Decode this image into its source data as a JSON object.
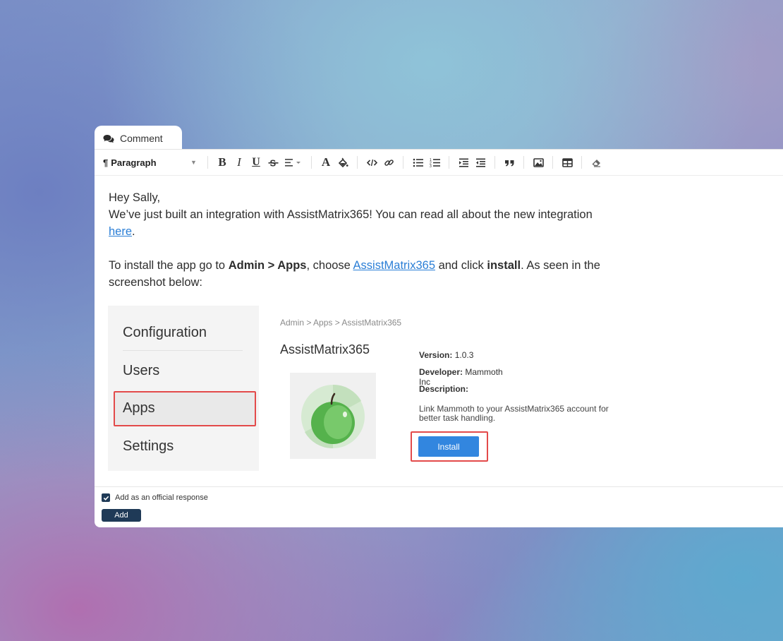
{
  "tab": {
    "label": "Comment",
    "icon": "comments-icon"
  },
  "toolbar": {
    "paragraph_label": "Paragraph",
    "bold": "B",
    "italic": "I",
    "underline": "U",
    "font_color": "A"
  },
  "content": {
    "greeting": "Hey Sally,",
    "line1": "We’ve just built an integration with AssistMatrix365! You can read all about the new integration",
    "link_here": "here",
    "line1_end": ".",
    "line2_a": "To install the app go to ",
    "line2_bold1": "Admin > Apps",
    "line2_b": ", choose ",
    "line2_link": "AssistMatrix365",
    "line2_c": " and click ",
    "line2_bold2": "install",
    "line2_d": ". As seen in the screenshot below:"
  },
  "screenshot": {
    "menu": [
      "Configuration",
      "Users",
      "Apps",
      "Settings"
    ],
    "breadcrumb": "Admin > Apps > AssistMatrix365",
    "app_name": "AssistMatrix365",
    "version_label": "Version:",
    "version": "1.0.3",
    "developer_label": "Developer:",
    "developer": "Mammoth Inc",
    "description_label": "Description:",
    "description": "Link Mammoth to your AssistMatrix365 account for better task handling.",
    "install_label": "Install"
  },
  "footer": {
    "official_response_label": "Add as an official response",
    "add_label": "Add"
  },
  "colors": {
    "link": "#2a7ed6",
    "install": "#3286df",
    "highlight": "#e34a4a",
    "dark_button": "#1f3a57"
  }
}
